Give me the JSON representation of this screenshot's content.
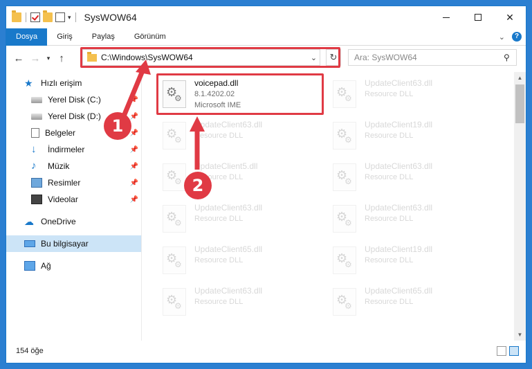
{
  "window": {
    "title": "SysWOW64"
  },
  "ribbon": {
    "tabs": [
      "Dosya",
      "Giriş",
      "Paylaş",
      "Görünüm"
    ]
  },
  "navbar": {
    "address_path": "C:\\Windows\\SysWOW64",
    "search_placeholder": "Ara: SysWOW64"
  },
  "sidebar": {
    "quick_access": "Hızlı erişim",
    "pinned": [
      {
        "label": "Yerel Disk (C:)",
        "icon": "drive-icon"
      },
      {
        "label": "Yerel Disk (D:)",
        "icon": "drive-icon"
      },
      {
        "label": "Belgeler",
        "icon": "documents-icon"
      },
      {
        "label": "İndirmeler",
        "icon": "downloads-icon"
      },
      {
        "label": "Müzik",
        "icon": "music-icon"
      },
      {
        "label": "Resimler",
        "icon": "pictures-icon"
      },
      {
        "label": "Videolar",
        "icon": "videos-icon"
      }
    ],
    "onedrive": "OneDrive",
    "this_pc": "Bu bilgisayar",
    "network": "Ağ"
  },
  "files": {
    "highlighted": {
      "name": "voicepad.dll",
      "version": "8.1.4202.02",
      "company": "Microsoft IME"
    },
    "left": [
      {
        "name": "UpdateClient63.dll",
        "sub": "Resource DLL"
      },
      {
        "name": "UpdateClient5.dll",
        "sub": "Resource DLL"
      },
      {
        "name": "UpdateClient63.dll",
        "sub": "Resource DLL"
      },
      {
        "name": "UpdateClient65.dll",
        "sub": "Resource DLL"
      },
      {
        "name": "UpdateClient63.dll",
        "sub": "Resource DLL"
      }
    ],
    "right": [
      {
        "name": "UpdateClient63.dll",
        "sub": "Resource DLL"
      },
      {
        "name": "UpdateClient19.dll",
        "sub": "Resource DLL"
      },
      {
        "name": "UpdateClient63.dll",
        "sub": "Resource DLL"
      },
      {
        "name": "UpdateClient63.dll",
        "sub": "Resource DLL"
      },
      {
        "name": "UpdateClient19.dll",
        "sub": "Resource DLL"
      },
      {
        "name": "UpdateClient65.dll",
        "sub": "Resource DLL"
      }
    ]
  },
  "status": {
    "count": "154 öğe"
  },
  "annotations": {
    "step1": "1",
    "step2": "2",
    "color": "#e03a44"
  }
}
